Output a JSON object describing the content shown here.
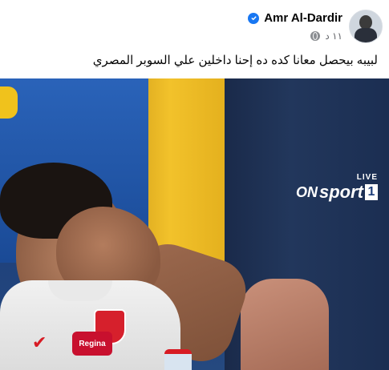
{
  "post": {
    "author_name": "Amr Al-Dardir",
    "timestamp": "١١ د",
    "caption": "لبيبه بيحصل معانا كده ده إحنا داخلين علي السوبر المصري"
  },
  "media": {
    "channel_live": "LIVE",
    "channel_on": "ON",
    "channel_sport": "sport",
    "channel_number": "1",
    "sponsor_text": "Regina"
  }
}
